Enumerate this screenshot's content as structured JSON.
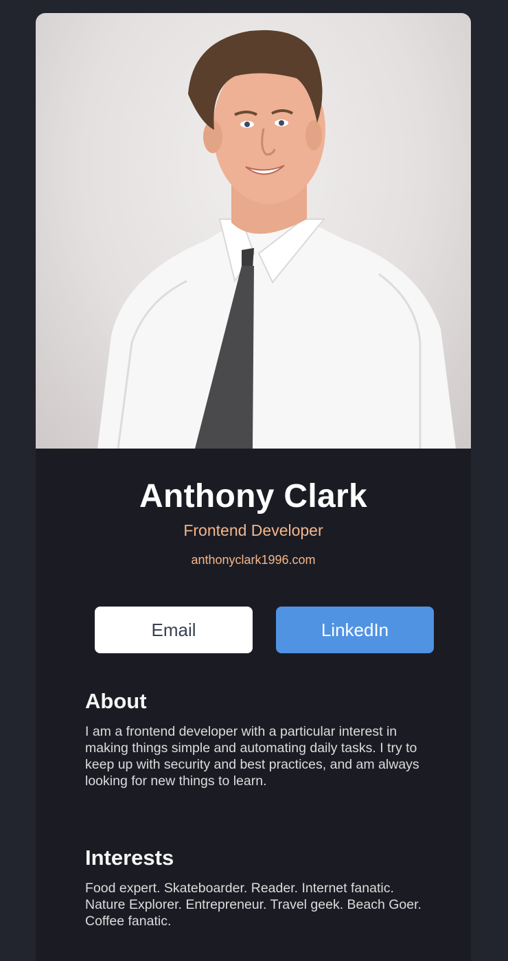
{
  "profile": {
    "photo_icon": "person-portrait",
    "name": "Anthony Clark",
    "role": "Frontend Developer",
    "website": "anthonyclark1996.com"
  },
  "buttons": {
    "email_label": "Email",
    "linkedin_label": "LinkedIn"
  },
  "about": {
    "title": "About",
    "text": "I am a frontend developer with a particular interest in making things simple and automating daily tasks. I try to keep up with security and best practices, and am always looking for new things to learn."
  },
  "interests": {
    "title": "Interests",
    "text": "Food expert. Skateboarder. Reader. Internet fanatic. Nature Explorer. Entrepreneur. Travel geek. Beach Goer. Coffee fanatic."
  },
  "colors": {
    "page_bg": "#23252e",
    "card_bg": "#1b1c23",
    "accent": "#f3b68c",
    "linkedin_blue": "#5093e2"
  }
}
